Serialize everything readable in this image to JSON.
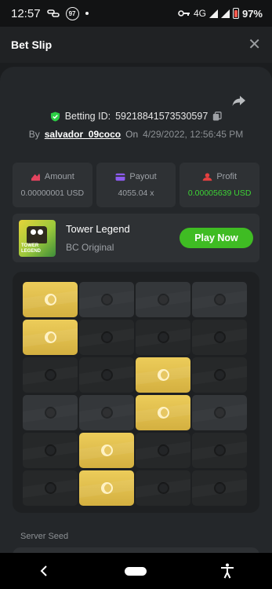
{
  "status_bar": {
    "time": "12:57",
    "notification_badge": "97",
    "network": "4G",
    "battery": "97%"
  },
  "header": {
    "title": "Bet Slip",
    "close_icon": "close-icon"
  },
  "bet": {
    "betting_id_label": "Betting ID:",
    "betting_id": "59218841573530597",
    "by_label": "By",
    "username": "salvador_09coco",
    "on_label": "On",
    "datetime": "4/29/2022, 12:56:45 PM"
  },
  "stats": [
    {
      "label": "Amount",
      "value": "0.00000001 USD",
      "icon": "amount-icon",
      "color": "#e3435e"
    },
    {
      "label": "Payout",
      "value": "4055.04 x",
      "icon": "payout-icon",
      "color": "#8d5bf0"
    },
    {
      "label": "Profit",
      "value": "0.00005639 USD",
      "icon": "profit-icon",
      "color": "#e34040"
    }
  ],
  "game": {
    "name": "Tower Legend",
    "provider": "BC Original",
    "thumb_text": "TOWER LEGEND",
    "play_label": "Play Now"
  },
  "board": {
    "rows": [
      [
        "gold",
        "dim",
        "dim",
        "dim"
      ],
      [
        "gold",
        "dark",
        "dark",
        "dark"
      ],
      [
        "dark",
        "dark",
        "gold",
        "dark"
      ],
      [
        "dim",
        "dim",
        "gold",
        "dim"
      ],
      [
        "dark",
        "gold",
        "dark",
        "dark"
      ],
      [
        "dark",
        "gold",
        "dark",
        "dark"
      ]
    ]
  },
  "server_seed": {
    "label": "Server Seed"
  },
  "colors": {
    "accent_green": "#3fbc23",
    "profit_green": "#3dd335",
    "tile_gold": "#e0bf4d",
    "background": "#1b1d1f"
  }
}
